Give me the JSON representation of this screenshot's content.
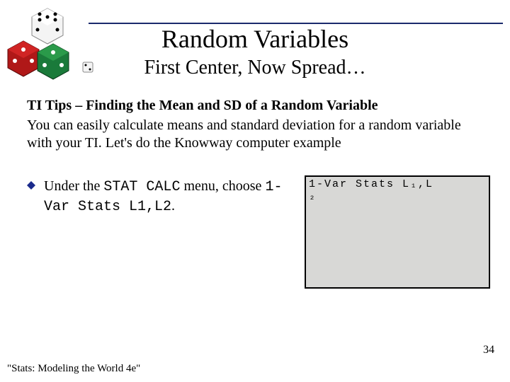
{
  "title": "Random Variables",
  "subtitle": "First Center, Now Spread…",
  "section": {
    "heading": "TI Tips – Finding the Mean and SD of a Random Variable",
    "body": "You can easily calculate means and standard deviation for a random variable with your TI. Let's do the Knowway computer example"
  },
  "bullet": {
    "pre": "Under the ",
    "code1": "STAT CALC",
    "mid": " menu, choose ",
    "code2": "1-Var Stats L1,L2",
    "post": "."
  },
  "calculator": {
    "line1": "1-Var Stats L₁,L",
    "line2": "₂"
  },
  "page_number": "34",
  "citation": "\"Stats: Modeling the World 4e\""
}
